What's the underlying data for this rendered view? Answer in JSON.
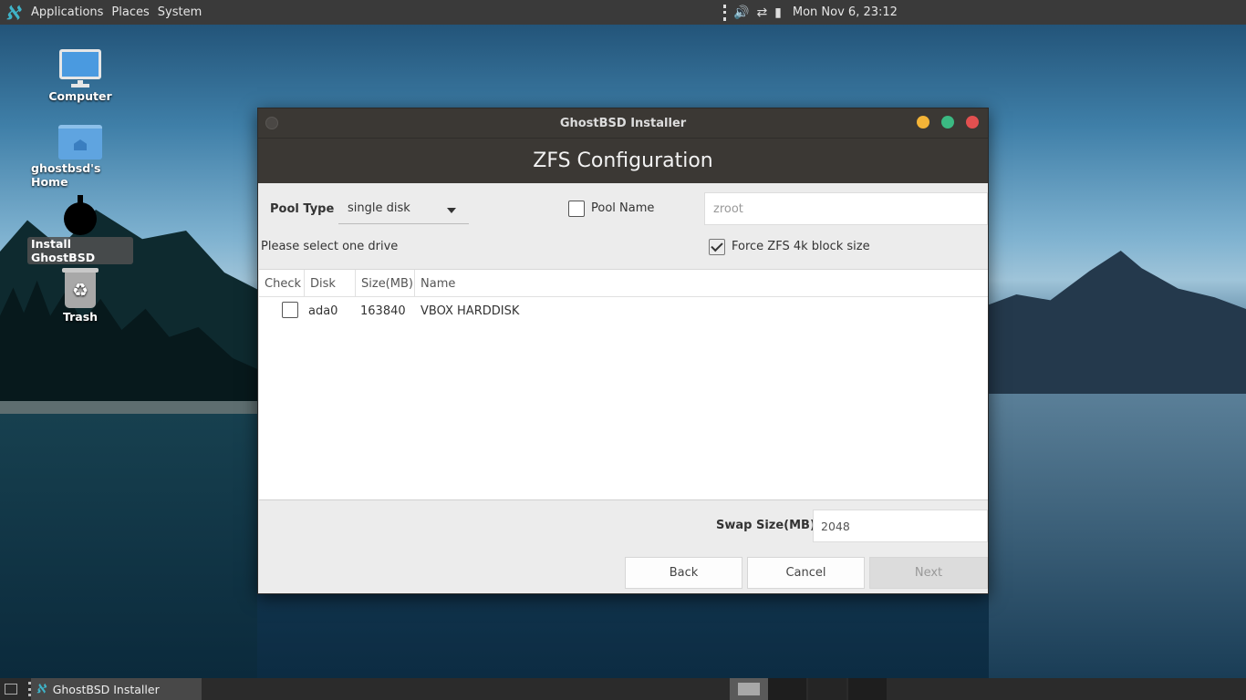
{
  "top_panel": {
    "logo_icon": "ghostbsd-logo-icon",
    "menus": [
      "Applications",
      "Places",
      "System"
    ],
    "tray_icons": [
      "volume-icon",
      "network-icon",
      "battery-icon"
    ],
    "clock": "Mon Nov  6, 23:12"
  },
  "desktop": {
    "icons": [
      {
        "label": "Computer",
        "icon": "computer-icon"
      },
      {
        "label": "ghostbsd's Home",
        "icon": "home-folder-icon"
      },
      {
        "label": "Install GhostBSD",
        "icon": "installer-icon"
      },
      {
        "label": "Trash",
        "icon": "trash-icon"
      }
    ]
  },
  "window": {
    "title": "GhostBSD Installer",
    "header": "ZFS Configuration",
    "pool_type": {
      "label": "Pool Type",
      "value": "single disk"
    },
    "pool_name": {
      "label": "Pool Name",
      "checked": false,
      "placeholder": "zroot"
    },
    "select_drive_text": "Please select one drive",
    "force_4k": {
      "label": "Force ZFS 4k block size",
      "checked": true
    },
    "table": {
      "columns": [
        "Check",
        "Disk",
        "Size(MB)",
        "Name"
      ],
      "rows": [
        {
          "checked": false,
          "disk": "ada0",
          "size": "163840",
          "name": "VBOX HARDDISK"
        }
      ]
    },
    "swap": {
      "label": "Swap Size(MB)",
      "value": "2048"
    },
    "buttons": {
      "back": "Back",
      "cancel": "Cancel",
      "next": "Next"
    }
  },
  "bottom_panel": {
    "task_label": "GhostBSD Installer"
  },
  "colors": {
    "titlebar": "#3b3834",
    "minimize": "#f4b437",
    "maximize": "#3bb982",
    "close": "#e25050",
    "accent": "#3fb3c8"
  }
}
